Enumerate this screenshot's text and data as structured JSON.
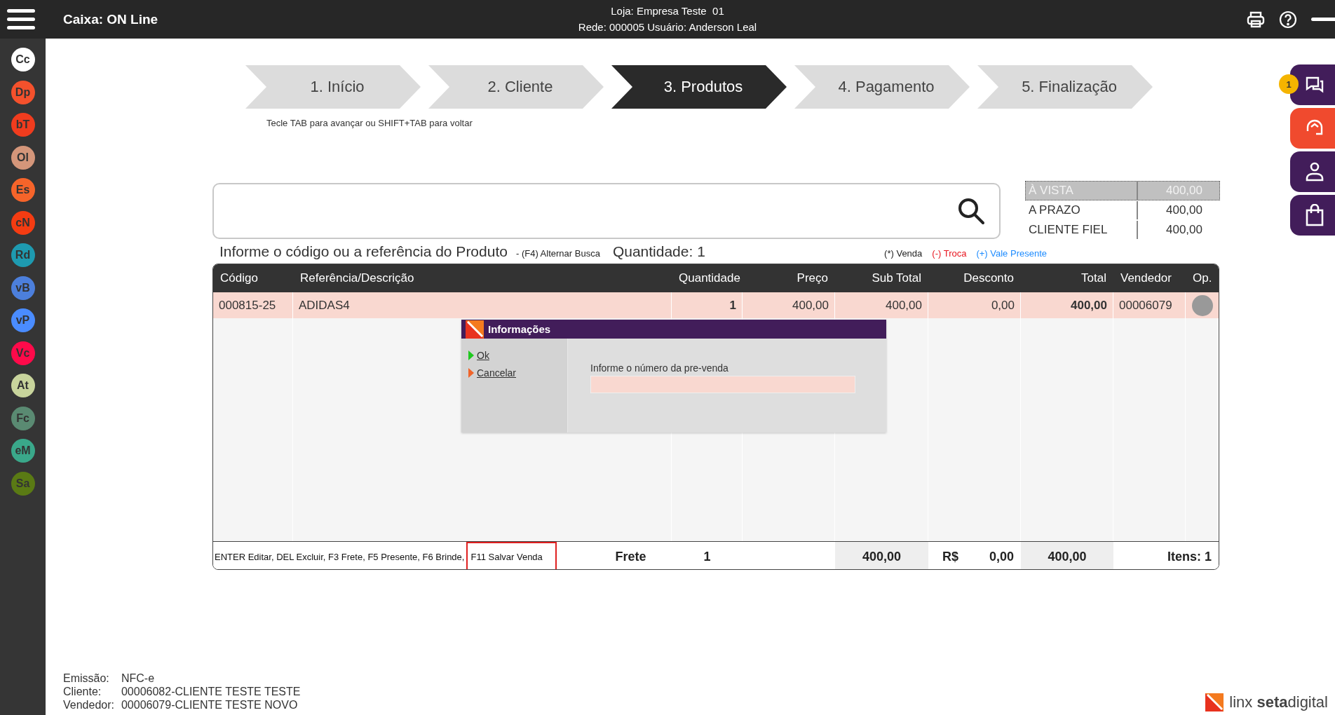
{
  "topbar": {
    "title": "Caixa: ON Line",
    "store_line": "Loja: Empresa Teste  01",
    "network_line": "Rede: 000005 Usuário: Anderson Leal"
  },
  "sidebar": {
    "items": [
      {
        "label": "Cc",
        "color": "#ffffff"
      },
      {
        "label": "Dp",
        "color": "#f4512c"
      },
      {
        "label": "bT",
        "color": "#f03c1e"
      },
      {
        "label": "Ol",
        "color": "#d4967a"
      },
      {
        "label": "Es",
        "color": "#f6642a"
      },
      {
        "label": "cN",
        "color": "#f43c12"
      },
      {
        "label": "Rd",
        "color": "#1e9ab0"
      },
      {
        "label": "vB",
        "color": "#4c7fdc"
      },
      {
        "label": "vP",
        "color": "#4a8cff"
      },
      {
        "label": "Vc",
        "color": "#ff0a4a"
      },
      {
        "label": "At",
        "color": "#c8d49c"
      },
      {
        "label": "Fc",
        "color": "#5a8a72"
      },
      {
        "label": "eM",
        "color": "#3aa88a"
      },
      {
        "label": "Sa",
        "color": "#5a7a14"
      }
    ]
  },
  "steps": [
    {
      "label": "1. Início",
      "selected": false
    },
    {
      "label": "2. Cliente",
      "selected": false
    },
    {
      "label": "3. Produtos",
      "selected": true
    },
    {
      "label": "4. Pagamento",
      "selected": false
    },
    {
      "label": "5. Finalização",
      "selected": false
    }
  ],
  "step_hint": "Tecle TAB para avançar ou SHIFT+TAB para voltar",
  "price_table": [
    {
      "label": "À VISTA",
      "value": "400,00",
      "selected": true
    },
    {
      "label": "A PRAZO",
      "value": "400,00",
      "selected": false
    },
    {
      "label": "CLIENTE FIEL",
      "value": "400,00",
      "selected": false
    }
  ],
  "search": {
    "label": "Informe o código ou a referência do Produto",
    "toggle_hint": "- (F4) Alternar Busca",
    "quantity": "Quantidade: 1",
    "legend": [
      {
        "label": "(*) Venda",
        "color": "#222222"
      },
      {
        "label": "(-) Troca",
        "color": "#e8141e"
      },
      {
        "label": "(+) Vale Presente",
        "color": "#1e8cff"
      }
    ]
  },
  "table": {
    "columns": [
      "Código",
      "Referência/Descrição",
      "Quantidade",
      "Preço",
      "Sub Total",
      "Desconto",
      "Total",
      "Vendedor",
      "Op."
    ],
    "rows": [
      {
        "code": "000815-25",
        "description": "ADIDAS4",
        "quantity": "1",
        "price": "400,00",
        "subtotal": "400,00",
        "discount": "0,00",
        "total": "400,00",
        "seller": "00006079"
      }
    ],
    "footer": {
      "shortcuts": "ENTER Editar, DEL Excluir, F3 Frete, F5 Presente, F6 Brinde,",
      "highlighted_shortcut": "F11 Salvar Venda",
      "freight_label": "Frete",
      "quantity": "1",
      "subtotal": "400,00",
      "currency": "R$",
      "discount": "0,00",
      "total": "400,00",
      "items": "Itens: 1"
    }
  },
  "dialog": {
    "title": "Informações",
    "actions": [
      {
        "label": "Ok",
        "kind": "confirm"
      },
      {
        "label": "Cancelar",
        "kind": "cancel"
      }
    ],
    "field_label": "Informe o número da pre-venda"
  },
  "side_panel": [
    {
      "kind": "chat",
      "badge": "1"
    },
    {
      "kind": "support"
    },
    {
      "kind": "user"
    },
    {
      "kind": "bag"
    }
  ],
  "sale_info": [
    {
      "label": "Emissão:",
      "value": "NFC-e"
    },
    {
      "label": "Cliente:",
      "value": "00006082-CLIENTE TESTE TESTE"
    },
    {
      "label": "Vendedor:",
      "value": "00006079-CLIENTE TESTE NOVO"
    }
  ],
  "brand": "linx **seta**digital"
}
